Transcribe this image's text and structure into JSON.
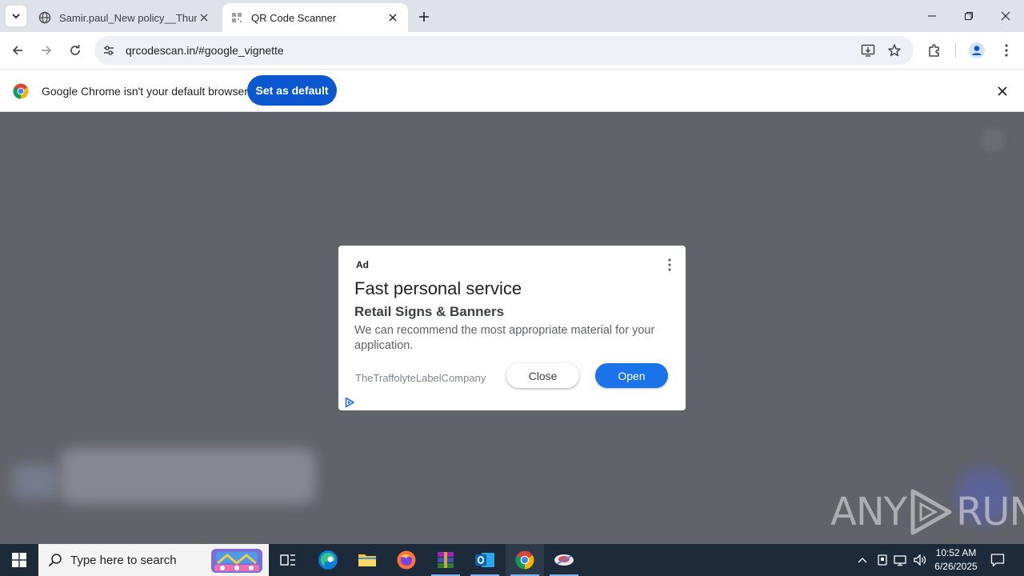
{
  "browser": {
    "tabs": [
      {
        "label": "Samir.paul_New policy__Thursd",
        "active": false
      },
      {
        "label": "QR Code Scanner",
        "active": true
      }
    ],
    "address": {
      "url": "qrcodescan.in/#google_vignette"
    }
  },
  "infobar": {
    "message": "Google Chrome isn't your default browser",
    "button_label": "Set as default"
  },
  "ad": {
    "label": "Ad",
    "title": "Fast personal service",
    "subtitle": "Retail Signs & Banners",
    "description": "We can recommend the most appropriate material for your application.",
    "advertiser": "TheTraffolyteLabelCompany",
    "close_label": "Close",
    "open_label": "Open"
  },
  "watermark": {
    "left": "ANY",
    "right": "RUN"
  },
  "taskbar": {
    "search_placeholder": "Type here to search",
    "time": "10:52 AM",
    "date": "6/26/2025"
  },
  "colors": {
    "primary_button": "#0b57d0",
    "ad_open_button": "#1a73e8",
    "overlay": "#606367",
    "taskbar": "#1c2a3a"
  }
}
